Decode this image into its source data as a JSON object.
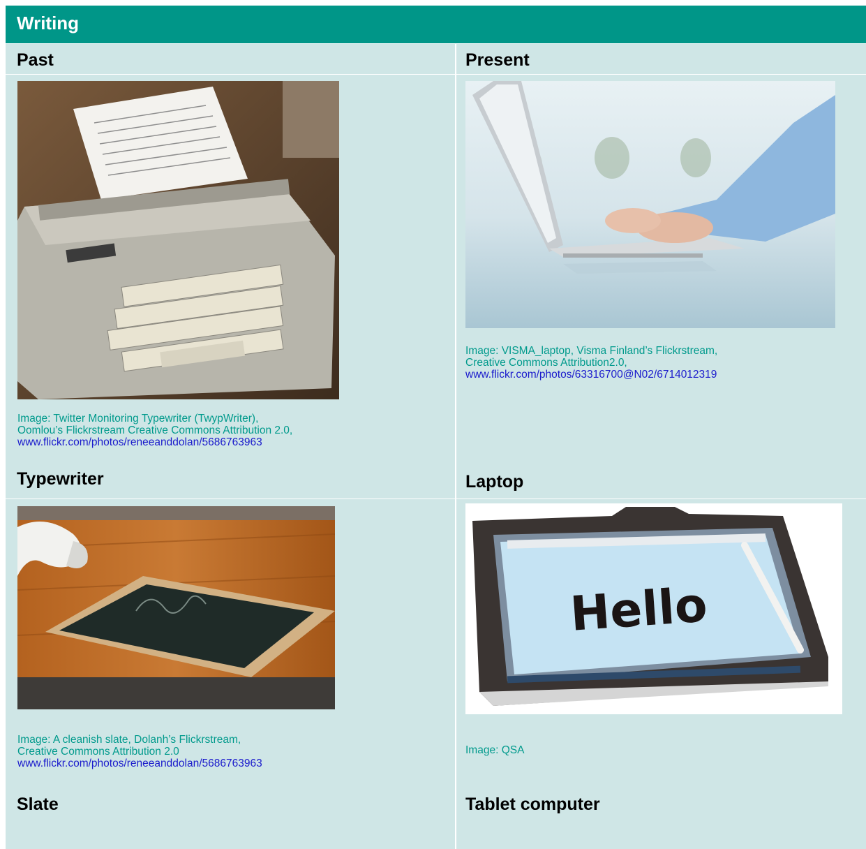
{
  "title": "Writing",
  "columns": {
    "left": "Past",
    "right": "Present"
  },
  "items": [
    {
      "caption_line1": "Image: Twitter Monitoring Typewriter (TwypWriter),",
      "caption_line2": "Oomlou’s Flickrstream Creative Commons Attribution 2.0,",
      "caption_link": "www.flickr.com/photos/reneeanddolan/5686763963",
      "label": "Typewriter",
      "photo": "typewriter"
    },
    {
      "caption_line1": "Image: VISMA_laptop, Visma Finland’s Flickrstream,",
      "caption_line2": "Creative Commons Attribution2.0,",
      "caption_link": "www.flickr.com/photos/63316700@N02/6714012319",
      "label": "Laptop",
      "photo": "laptop"
    },
    {
      "caption_line1": "Image: A cleanish slate, Dolanh’s Flickrstream,",
      "caption_line2": "Creative Commons Attribution 2.0",
      "caption_link": "www.flickr.com/photos/reneeanddolan/5686763963",
      "label": "Slate",
      "photo": "slate"
    },
    {
      "caption_line1": "Image: QSA",
      "caption_line2": "",
      "caption_link": "",
      "label": "Tablet computer",
      "photo": "tablet"
    }
  ],
  "tablet_screen_text": "Hello",
  "colors": {
    "header": "#009688",
    "cell": "#cfe6e6",
    "caption": "#009a8c",
    "link": "#1a1acc"
  }
}
